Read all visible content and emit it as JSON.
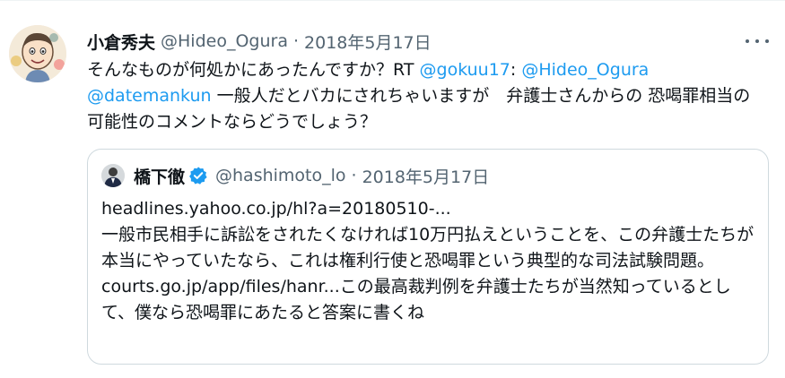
{
  "tweet": {
    "author_name": "小倉秀夫",
    "handle": "@Hideo_Ogura",
    "separator": "·",
    "date": "2018年5月17日",
    "text_part1": "そんなものが何処かにあったんですか？RT ",
    "mention1": "@gokuu17",
    "text_part2": ": ",
    "mention2": "@Hideo_Ogura",
    "text_part3": " ",
    "mention3": "@datemankun",
    "text_part4": " 一般人だとバカにされちゃいますが　弁護士さんからの 恐喝罪相当の可能性のコメントならどうでしょう？"
  },
  "quoted_tweet": {
    "author_name": "橋下徹",
    "handle": "@hashimoto_lo",
    "separator": "·",
    "date": "2018年5月17日",
    "link_text": "headlines.yahoo.co.jp/hl?a=20180510-...",
    "body": "一般市民相手に訴訟をされたくなければ10万円払えということを、この弁護士たちが本当にやっていたなら、これは権利行使と恐喝罪という典型的な司法試験問題。courts.go.jp/app/files/hanr...この最高裁判例を弁護士たちが当然知っているとして、僕なら恐喝罪にあたると答案に書くね"
  },
  "colors": {
    "link": "#1d9bf0",
    "secondary_text": "#536471",
    "border": "#cfd9de",
    "verified_badge": "#1d9bf0"
  },
  "icons": {
    "more": "more-options-icon",
    "verified": "verified-badge-icon"
  }
}
